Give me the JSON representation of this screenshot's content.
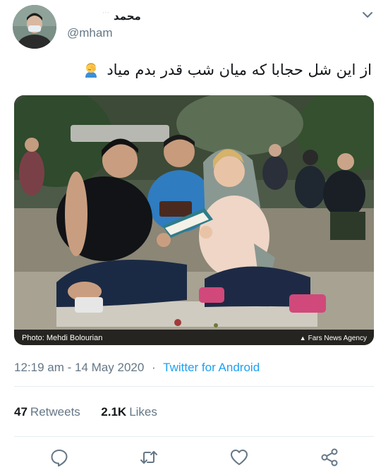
{
  "header": {
    "display_name": "محمد",
    "handle": "@mham"
  },
  "tweet": {
    "text": "از این شل حجابا که میان شب قدر بدم میاد",
    "emoji": "man-facepalming"
  },
  "media": {
    "photo_credit": "Photo: Mehdi Bolourian",
    "agency": "Fars News Agency"
  },
  "meta": {
    "time": "12:19 am",
    "separator": "·",
    "date": "14 May 2020",
    "source": "Twitter for Android"
  },
  "stats": {
    "retweets_count": "47",
    "retweets_label": "Retweets",
    "likes_count": "2.1K",
    "likes_label": "Likes"
  },
  "colors": {
    "text": "#14171a",
    "secondary": "#657786",
    "link": "#1da1f2",
    "divider": "#e6ecf0"
  },
  "icons": {
    "reply": "reply-icon",
    "retweet": "retweet-icon",
    "like": "heart-icon",
    "share": "share-icon",
    "menu": "chevron-down-icon"
  }
}
